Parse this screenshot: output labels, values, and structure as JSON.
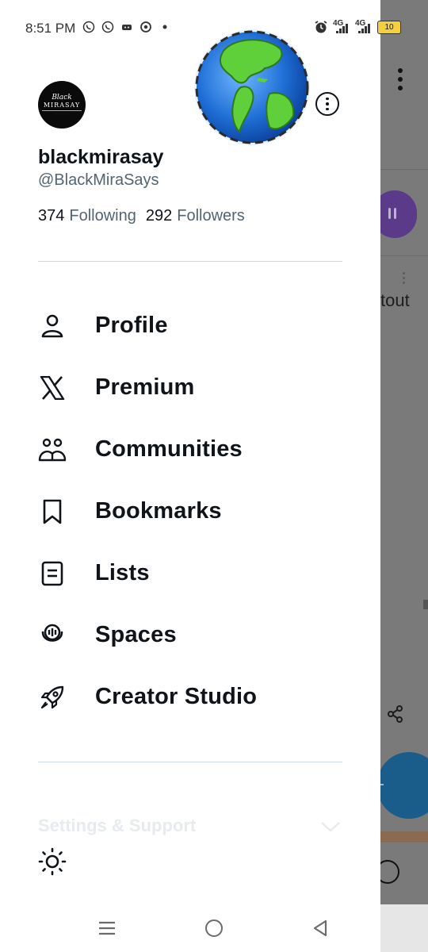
{
  "status_bar": {
    "time": "8:51 PM",
    "network_1": "4G",
    "network_2": "4G",
    "battery": "10"
  },
  "profile": {
    "avatar_text_1": "Black",
    "avatar_text_2": "MIRASAY",
    "display_name": "blackmirasay",
    "handle": "@BlackMiraSays",
    "following_count": "374",
    "following_label": "Following",
    "followers_count": "292",
    "followers_label": "Followers"
  },
  "menu": [
    {
      "label": "Profile",
      "icon": "person-icon"
    },
    {
      "label": "Premium",
      "icon": "x-logo-icon"
    },
    {
      "label": "Communities",
      "icon": "communities-icon"
    },
    {
      "label": "Bookmarks",
      "icon": "bookmark-icon"
    },
    {
      "label": "Lists",
      "icon": "list-icon"
    },
    {
      "label": "Spaces",
      "icon": "spaces-icon"
    },
    {
      "label": "Creator Studio",
      "icon": "rocket-icon"
    }
  ],
  "settings": {
    "label": "Settings & Support"
  },
  "background_app": {
    "partial_text": "tout"
  },
  "colors": {
    "primary_text": "#0f1419",
    "secondary_text": "#536471",
    "divider": "#cfd9de",
    "overlay": "#7a7a7a"
  }
}
